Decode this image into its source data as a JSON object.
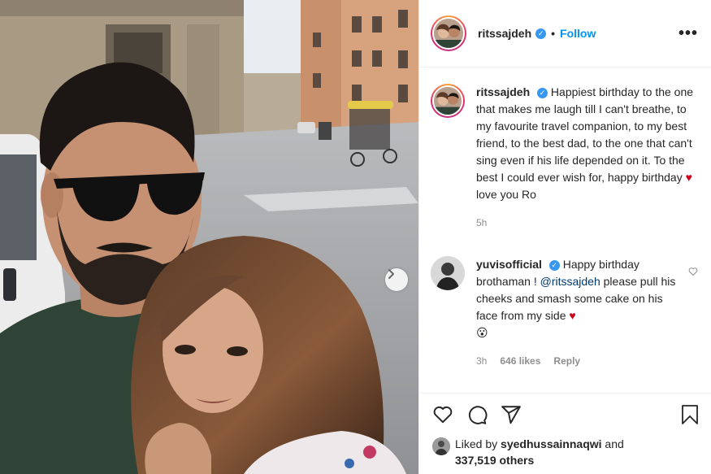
{
  "header": {
    "username": "ritssajdeh",
    "separator": "•",
    "follow_label": "Follow",
    "more_label": "•••"
  },
  "caption": {
    "username": "ritssajdeh",
    "text_before_heart": "Happiest birthday to the one that makes me laugh till I can't breathe, to my favourite travel companion, to my best friend, to the best dad, to the one that can't sing even if his life depended on it. To the best I could ever wish for, happy birthday",
    "heart": "♥",
    "text_after_heart": "love you Ro",
    "time": "5h"
  },
  "comment": {
    "username": "yuvisofficial",
    "text_part1": "Happy birthday brothaman ! ",
    "mention": "@ritssajdeh",
    "text_part2": " please pull his cheeks and smash some cake on his face from my side",
    "heart": "♥",
    "emoji": "😮",
    "time": "3h",
    "likes": "646 likes",
    "reply_label": "Reply"
  },
  "likes": {
    "prefix": "Liked by",
    "user": "syedhussainnaqwi",
    "and": "and",
    "others": "337,519 others"
  },
  "icons": {
    "heart": "heart-icon",
    "comment": "comment-icon",
    "share": "share-icon",
    "save": "bookmark-icon",
    "next": "chevron-right-icon"
  },
  "colors": {
    "link": "#0095f6",
    "verified": "#3897f0",
    "muted": "#8e8e8e",
    "heart": "#d0021b"
  }
}
